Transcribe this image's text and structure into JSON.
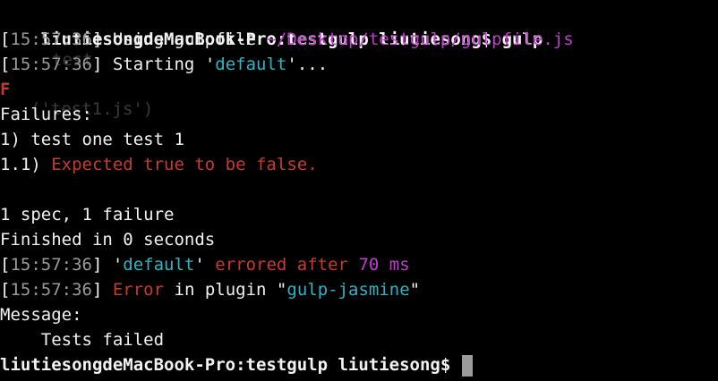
{
  "terminal": {
    "background": "#000000",
    "colors": {
      "text": "#f2f2f2",
      "timestamp": "#9a9a9a",
      "path": "#c33bd1",
      "task": "#2fb4c6",
      "error": "#c73a2c",
      "cursor": "#9b9b9b"
    },
    "ghost_text": {
      "line1": "test",
      "line2": "('test1.js')"
    },
    "lines": {
      "prompt1": {
        "prompt": "liutiesongdeMacBook-Pro:testgulp liutiesong$",
        "command": "gulp"
      },
      "using": {
        "time": "15:57:36",
        "text": "Using gulpfile",
        "path": "~/Desktop/testgulp/gulpfile.js"
      },
      "starting": {
        "time": "15:57:36",
        "text": "Starting",
        "task": "default",
        "suffix": "..."
      },
      "f_marker": "F",
      "failures": "Failures:",
      "test_line": "1) test one test 1",
      "expectation": {
        "prefix": "1.1)",
        "message": "Expected true to be false."
      },
      "spec_summary": "1 spec, 1 failure",
      "finished": "Finished in 0 seconds",
      "errored": {
        "time": "15:57:36",
        "task": "default",
        "text": "errored after",
        "duration": "70 ms"
      },
      "plugin_error": {
        "time": "15:57:36",
        "error": "Error",
        "text": "in plugin",
        "plugin": "gulp-jasmine"
      },
      "message_label": "Message:",
      "message_text": "    Tests failed",
      "prompt2": {
        "prompt": "liutiesongdeMacBook-Pro:testgulp liutiesong$"
      }
    }
  }
}
